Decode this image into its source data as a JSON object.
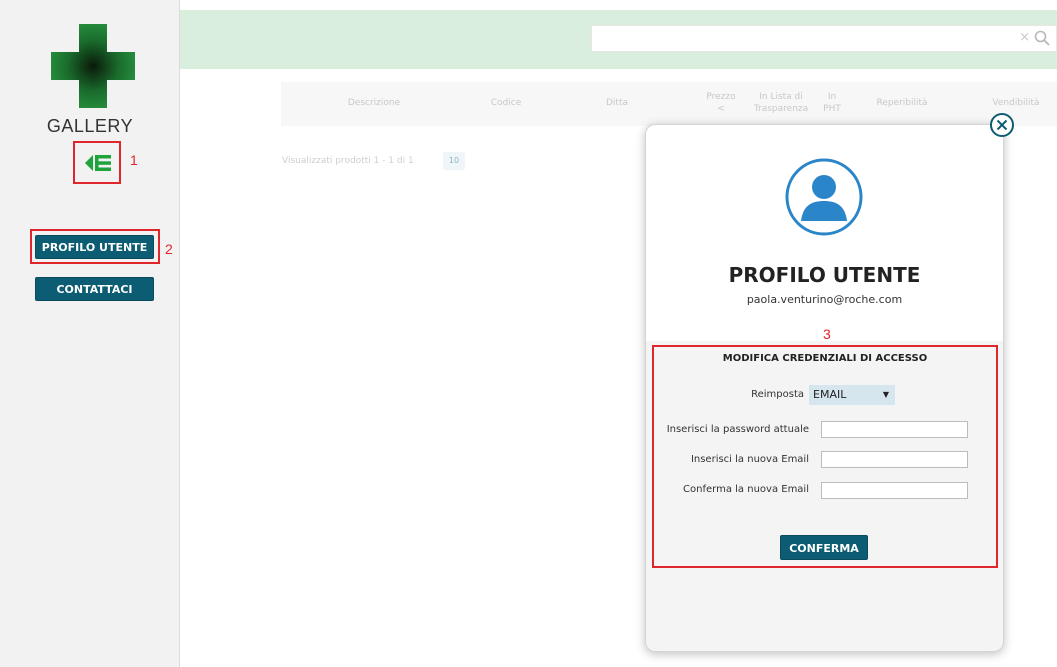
{
  "sidebar": {
    "title": "GALLERY",
    "buttons": [
      {
        "label": "PROFILO UTENTE"
      },
      {
        "label": "CONTATTACI"
      }
    ],
    "annotations": [
      "1",
      "2"
    ]
  },
  "search": {
    "value": "",
    "clear_icon": "×"
  },
  "table": {
    "headers": [
      "Descrizione",
      "Codice",
      "Ditta",
      "Prezzo",
      "In Lista di Trasparenza",
      "In PHT",
      "Reperibilità",
      "Vendibilità"
    ],
    "results_info": "Visualizzati prodotti 1 - 1 di 1",
    "per_page": "10"
  },
  "modal": {
    "title": "PROFILO UTENTE",
    "email": "paola.venturino@roche.com",
    "form_annotation": "3",
    "form": {
      "title": "MODIFICA CREDENZIALI DI ACCESSO",
      "reimposta_label": "Reimposta",
      "reimposta_value": "EMAIL",
      "current_password_label": "Inserisci la password attuale",
      "new_email_label": "Inserisci la nuova Email",
      "confirm_email_label": "Conferma la nuova Email",
      "submit_label": "CONFERMA"
    }
  },
  "colors": {
    "button": "#0c5c73",
    "annotation": "#e0262a",
    "header_bar": "#d9eedd",
    "avatar": "#2a86c9",
    "logo": "#1e7a34"
  },
  "icons": {
    "menu": "collapse-menu-icon",
    "close": "close-circle-icon",
    "avatar": "user-avatar-icon",
    "search": "search-icon",
    "dropdown": "triangle-down"
  }
}
